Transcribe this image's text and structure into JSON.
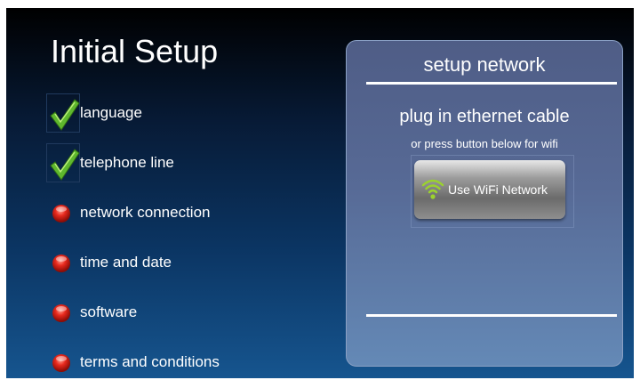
{
  "title": "Initial Setup",
  "steps": [
    {
      "label": "language",
      "status": "done",
      "icon": "checkmark-icon"
    },
    {
      "label": "telephone line",
      "status": "done",
      "icon": "checkmark-icon"
    },
    {
      "label": "network connection",
      "status": "pending",
      "icon": "red-dot-icon"
    },
    {
      "label": "time and date",
      "status": "pending",
      "icon": "red-dot-icon"
    },
    {
      "label": "software",
      "status": "pending",
      "icon": "red-dot-icon"
    },
    {
      "label": "terms and conditions",
      "status": "pending",
      "icon": "red-dot-icon"
    }
  ],
  "panel": {
    "title": "setup network",
    "subtitle": "plug in ethernet cable",
    "hint": "or press button below for wifi",
    "wifi_button": {
      "label": "Use WiFi Network",
      "icon": "wifi-icon"
    }
  },
  "colors": {
    "check_green": "#6cc234",
    "pending_red": "#e0201a",
    "wifi_green": "#9bd22e"
  }
}
